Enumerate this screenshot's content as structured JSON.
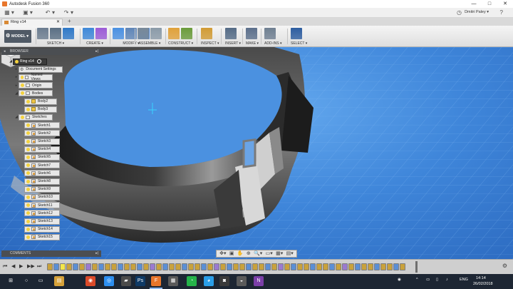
{
  "window": {
    "title": "Autodesk Fusion 360",
    "controls": [
      "—",
      "□",
      "✕"
    ]
  },
  "qat": {
    "user": "Dmitri Paley ▾",
    "buttons": [
      "▦ ▾",
      "▣ ▾",
      "↶",
      "▾",
      "↷",
      "▾"
    ],
    "clock_icon": "◷",
    "help_icon": "?"
  },
  "document": {
    "tab_label": "Ring v14",
    "tab_close": "✕",
    "add_tab": "+"
  },
  "ribbon": {
    "workspace": "MODEL ▾",
    "workspace_icon": "⚙",
    "groups": [
      {
        "label": "SKETCH ▾",
        "colors": [
          "#6b7c8f",
          "#5a6f84",
          "#2f78c7"
        ]
      },
      {
        "label": "CREATE ▾",
        "colors": [
          "#3f88d8",
          "#9b5bd6"
        ]
      },
      {
        "label": "MODIFY ▾",
        "colors": [
          "#4a90e2",
          "#5e85b7",
          "#3c77c9"
        ]
      },
      {
        "label": "ASSEMBLE ▾",
        "colors": [
          "#7a8a99",
          "#8a9aa8"
        ]
      },
      {
        "label": "CONSTRUCT ▾",
        "colors": [
          "#e0a13a",
          "#6a9b3b"
        ]
      },
      {
        "label": "INSPECT ▾",
        "colors": [
          "#d19b35"
        ]
      },
      {
        "label": "INSERT ▾",
        "colors": [
          "#546b86"
        ]
      },
      {
        "label": "MAKE ▾",
        "colors": [
          "#5b6f8b"
        ]
      },
      {
        "label": "ADD-INS ▾",
        "colors": [
          "#6f7f91"
        ]
      },
      {
        "label": "SELECT ▾",
        "colors": [
          "#2d5da0"
        ]
      }
    ]
  },
  "browser": {
    "title": "BROWSER",
    "items": [
      {
        "label": "Ring v14",
        "type": "root"
      },
      {
        "label": "Document Settings",
        "type": "settings"
      },
      {
        "label": "Named Views",
        "type": "folder"
      },
      {
        "label": "Origin",
        "type": "folder"
      },
      {
        "label": "Bodies",
        "type": "folder"
      },
      {
        "label": "Body2",
        "type": "body"
      },
      {
        "label": "Body3",
        "type": "body"
      },
      {
        "label": "Sketches",
        "type": "folder"
      },
      {
        "label": "Sketch1",
        "type": "sketch"
      },
      {
        "label": "Sketch2",
        "type": "sketch"
      },
      {
        "label": "Sketch3",
        "type": "sketch"
      },
      {
        "label": "Sketch4",
        "type": "sketch"
      },
      {
        "label": "Sketch5",
        "type": "sketch"
      },
      {
        "label": "Sketch7",
        "type": "sketch"
      },
      {
        "label": "Sketch6",
        "type": "sketch"
      },
      {
        "label": "Sketch8",
        "type": "sketch"
      },
      {
        "label": "Sketch9",
        "type": "sketch"
      },
      {
        "label": "Sketch10",
        "type": "sketch"
      },
      {
        "label": "Sketch11",
        "type": "sketch"
      },
      {
        "label": "Sketch12",
        "type": "sketch"
      },
      {
        "label": "Sketch13",
        "type": "sketch"
      },
      {
        "label": "Sketch14",
        "type": "sketch"
      },
      {
        "label": "Sketch15",
        "type": "sketch"
      }
    ]
  },
  "comments": {
    "title": "COMMENTS"
  },
  "navbar": {
    "icons": [
      "✥▾",
      "▣",
      "✋",
      "⊕",
      "🔍▾",
      "▭▾",
      "▦▾",
      "▤▾"
    ]
  },
  "timeline": {
    "controls": [
      "⏮",
      "◀",
      "▶",
      "▶▶",
      "⏭"
    ],
    "settings_icon": "⚙",
    "item_colors": [
      "#c9a23c",
      "#5b8fd6",
      "#c9a23c",
      "#c9a23c",
      "#5b8fd6",
      "#c9a23c",
      "#9b7ad0",
      "#c9a23c",
      "#5b8fd6",
      "#c9a23c"
    ]
  },
  "taskbar": {
    "apps": [
      "⊞",
      "○",
      "▭",
      "▤",
      "◉",
      "◎",
      "▰",
      "Ps",
      "F",
      "▦",
      "◔",
      "◕",
      "◙",
      "◒",
      "N"
    ],
    "app_colors": [
      "#1d2633",
      "#1d2633",
      "#1d2633",
      "#d6a23a",
      "#db4b2a",
      "#2d8ff0",
      "#4b4b4b",
      "#0f3a66",
      "#e8762b",
      "#5a5a5a",
      "#25b34a",
      "#2a9ee8",
      "#3a3a3a",
      "#5a5a5a",
      "#7b3fa8"
    ],
    "tray": [
      "◉",
      "^",
      "▭",
      "▯",
      "♪"
    ],
    "lang": "ENG",
    "time": "14:14",
    "date": "26/02/2018"
  }
}
